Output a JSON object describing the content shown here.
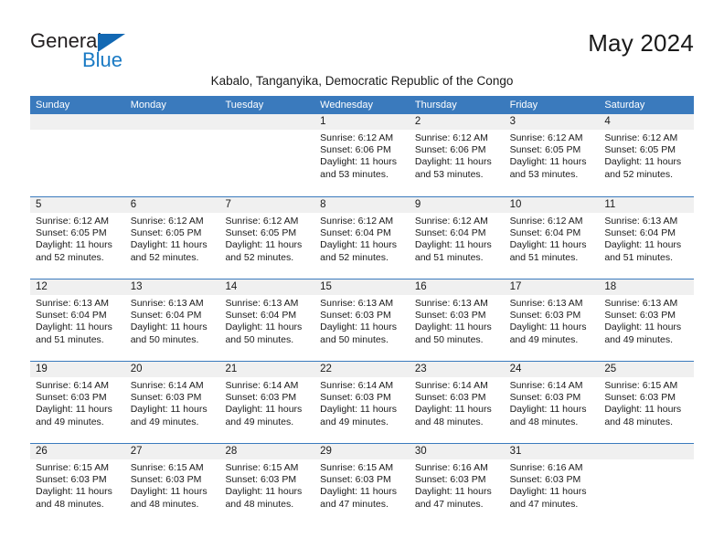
{
  "logo": {
    "word_primary": "General",
    "word_secondary": "Blue",
    "triangle_color": "#1268b3",
    "secondary_color": "#1a7ac4"
  },
  "header": {
    "title": "May 2024",
    "subtitle": "Kabalo, Tanganyika, Democratic Republic of the Congo"
  },
  "theme": {
    "header_blue": "#3a7abd",
    "daynum_band": "#f0f0f0",
    "text": "#1a1a1a"
  },
  "calendar": {
    "weekday_headers": [
      "Sunday",
      "Monday",
      "Tuesday",
      "Wednesday",
      "Thursday",
      "Friday",
      "Saturday"
    ],
    "weeks": [
      [
        {
          "day": "",
          "lines": []
        },
        {
          "day": "",
          "lines": []
        },
        {
          "day": "",
          "lines": []
        },
        {
          "day": "1",
          "lines": [
            "Sunrise: 6:12 AM",
            "Sunset: 6:06 PM",
            "Daylight: 11 hours",
            "and 53 minutes."
          ]
        },
        {
          "day": "2",
          "lines": [
            "Sunrise: 6:12 AM",
            "Sunset: 6:06 PM",
            "Daylight: 11 hours",
            "and 53 minutes."
          ]
        },
        {
          "day": "3",
          "lines": [
            "Sunrise: 6:12 AM",
            "Sunset: 6:05 PM",
            "Daylight: 11 hours",
            "and 53 minutes."
          ]
        },
        {
          "day": "4",
          "lines": [
            "Sunrise: 6:12 AM",
            "Sunset: 6:05 PM",
            "Daylight: 11 hours",
            "and 52 minutes."
          ]
        }
      ],
      [
        {
          "day": "5",
          "lines": [
            "Sunrise: 6:12 AM",
            "Sunset: 6:05 PM",
            "Daylight: 11 hours",
            "and 52 minutes."
          ]
        },
        {
          "day": "6",
          "lines": [
            "Sunrise: 6:12 AM",
            "Sunset: 6:05 PM",
            "Daylight: 11 hours",
            "and 52 minutes."
          ]
        },
        {
          "day": "7",
          "lines": [
            "Sunrise: 6:12 AM",
            "Sunset: 6:05 PM",
            "Daylight: 11 hours",
            "and 52 minutes."
          ]
        },
        {
          "day": "8",
          "lines": [
            "Sunrise: 6:12 AM",
            "Sunset: 6:04 PM",
            "Daylight: 11 hours",
            "and 52 minutes."
          ]
        },
        {
          "day": "9",
          "lines": [
            "Sunrise: 6:12 AM",
            "Sunset: 6:04 PM",
            "Daylight: 11 hours",
            "and 51 minutes."
          ]
        },
        {
          "day": "10",
          "lines": [
            "Sunrise: 6:12 AM",
            "Sunset: 6:04 PM",
            "Daylight: 11 hours",
            "and 51 minutes."
          ]
        },
        {
          "day": "11",
          "lines": [
            "Sunrise: 6:13 AM",
            "Sunset: 6:04 PM",
            "Daylight: 11 hours",
            "and 51 minutes."
          ]
        }
      ],
      [
        {
          "day": "12",
          "lines": [
            "Sunrise: 6:13 AM",
            "Sunset: 6:04 PM",
            "Daylight: 11 hours",
            "and 51 minutes."
          ]
        },
        {
          "day": "13",
          "lines": [
            "Sunrise: 6:13 AM",
            "Sunset: 6:04 PM",
            "Daylight: 11 hours",
            "and 50 minutes."
          ]
        },
        {
          "day": "14",
          "lines": [
            "Sunrise: 6:13 AM",
            "Sunset: 6:04 PM",
            "Daylight: 11 hours",
            "and 50 minutes."
          ]
        },
        {
          "day": "15",
          "lines": [
            "Sunrise: 6:13 AM",
            "Sunset: 6:03 PM",
            "Daylight: 11 hours",
            "and 50 minutes."
          ]
        },
        {
          "day": "16",
          "lines": [
            "Sunrise: 6:13 AM",
            "Sunset: 6:03 PM",
            "Daylight: 11 hours",
            "and 50 minutes."
          ]
        },
        {
          "day": "17",
          "lines": [
            "Sunrise: 6:13 AM",
            "Sunset: 6:03 PM",
            "Daylight: 11 hours",
            "and 49 minutes."
          ]
        },
        {
          "day": "18",
          "lines": [
            "Sunrise: 6:13 AM",
            "Sunset: 6:03 PM",
            "Daylight: 11 hours",
            "and 49 minutes."
          ]
        }
      ],
      [
        {
          "day": "19",
          "lines": [
            "Sunrise: 6:14 AM",
            "Sunset: 6:03 PM",
            "Daylight: 11 hours",
            "and 49 minutes."
          ]
        },
        {
          "day": "20",
          "lines": [
            "Sunrise: 6:14 AM",
            "Sunset: 6:03 PM",
            "Daylight: 11 hours",
            "and 49 minutes."
          ]
        },
        {
          "day": "21",
          "lines": [
            "Sunrise: 6:14 AM",
            "Sunset: 6:03 PM",
            "Daylight: 11 hours",
            "and 49 minutes."
          ]
        },
        {
          "day": "22",
          "lines": [
            "Sunrise: 6:14 AM",
            "Sunset: 6:03 PM",
            "Daylight: 11 hours",
            "and 49 minutes."
          ]
        },
        {
          "day": "23",
          "lines": [
            "Sunrise: 6:14 AM",
            "Sunset: 6:03 PM",
            "Daylight: 11 hours",
            "and 48 minutes."
          ]
        },
        {
          "day": "24",
          "lines": [
            "Sunrise: 6:14 AM",
            "Sunset: 6:03 PM",
            "Daylight: 11 hours",
            "and 48 minutes."
          ]
        },
        {
          "day": "25",
          "lines": [
            "Sunrise: 6:15 AM",
            "Sunset: 6:03 PM",
            "Daylight: 11 hours",
            "and 48 minutes."
          ]
        }
      ],
      [
        {
          "day": "26",
          "lines": [
            "Sunrise: 6:15 AM",
            "Sunset: 6:03 PM",
            "Daylight: 11 hours",
            "and 48 minutes."
          ]
        },
        {
          "day": "27",
          "lines": [
            "Sunrise: 6:15 AM",
            "Sunset: 6:03 PM",
            "Daylight: 11 hours",
            "and 48 minutes."
          ]
        },
        {
          "day": "28",
          "lines": [
            "Sunrise: 6:15 AM",
            "Sunset: 6:03 PM",
            "Daylight: 11 hours",
            "and 48 minutes."
          ]
        },
        {
          "day": "29",
          "lines": [
            "Sunrise: 6:15 AM",
            "Sunset: 6:03 PM",
            "Daylight: 11 hours",
            "and 47 minutes."
          ]
        },
        {
          "day": "30",
          "lines": [
            "Sunrise: 6:16 AM",
            "Sunset: 6:03 PM",
            "Daylight: 11 hours",
            "and 47 minutes."
          ]
        },
        {
          "day": "31",
          "lines": [
            "Sunrise: 6:16 AM",
            "Sunset: 6:03 PM",
            "Daylight: 11 hours",
            "and 47 minutes."
          ]
        },
        {
          "day": "",
          "lines": []
        }
      ]
    ]
  }
}
